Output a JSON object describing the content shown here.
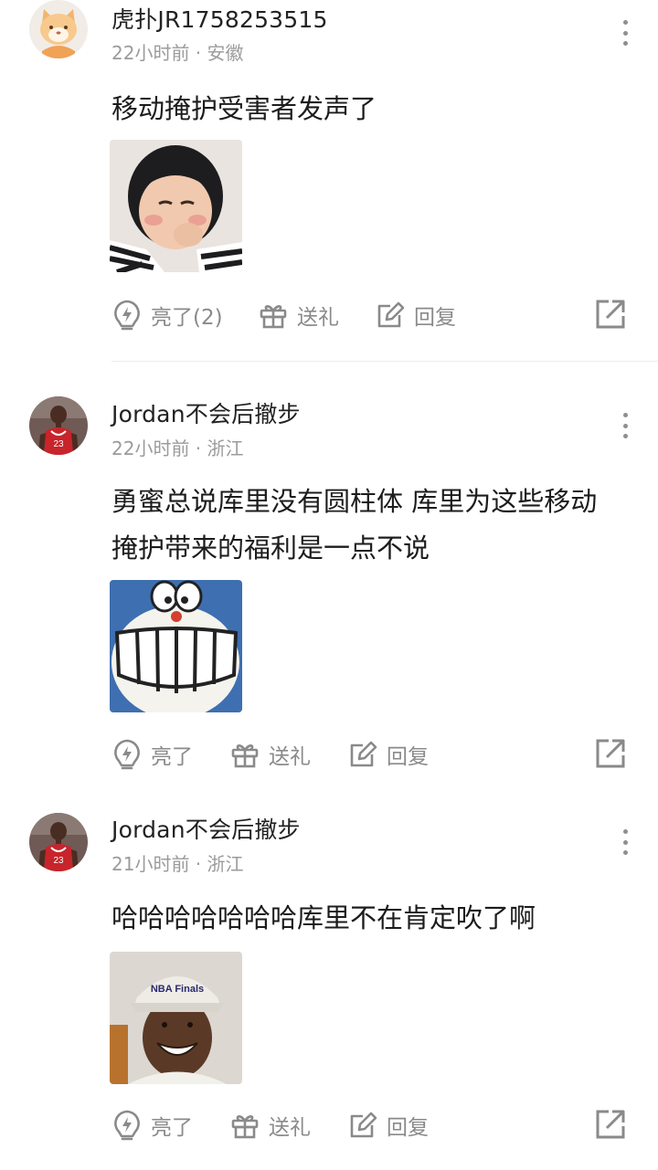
{
  "comments": [
    {
      "username": "虎扑JR1758253515",
      "meta": "22小时前 · 安徽",
      "content": "移动掩护受害者发声了",
      "avatar": "cat-avatar",
      "sticker": "baby-sticker",
      "actions": {
        "like": "亮了(2)",
        "gift": "送礼",
        "reply": "回复"
      }
    },
    {
      "username": "Jordan不会后撤步",
      "meta": "22小时前 · 浙江",
      "content": "勇蜜总说库里没有圆柱体 库里为这些移动掩护带来的福利是一点不说",
      "avatar": "basketball-player-avatar",
      "sticker": "doraemon-grin-sticker",
      "actions": {
        "like": "亮了",
        "gift": "送礼",
        "reply": "回复"
      }
    },
    {
      "username": "Jordan不会后撤步",
      "meta": "21小时前 · 浙江",
      "content": "哈哈哈哈哈哈哈库里不在肯定吹了啊",
      "avatar": "basketball-player-avatar",
      "sticker": "nba-finals-cap-smile-sticker",
      "sticker_text": "NBA Finals",
      "actions": {
        "like": "亮了",
        "gift": "送礼",
        "reply": "回复"
      }
    }
  ],
  "icons": {
    "like": "lightning-bulb-icon",
    "gift": "gift-icon",
    "reply": "edit-reply-icon",
    "share": "share-icon",
    "more": "more-vertical-icon"
  },
  "colors": {
    "text": "#1c1c1c",
    "meta": "#9b9b9b",
    "action": "#8a8a8a"
  }
}
